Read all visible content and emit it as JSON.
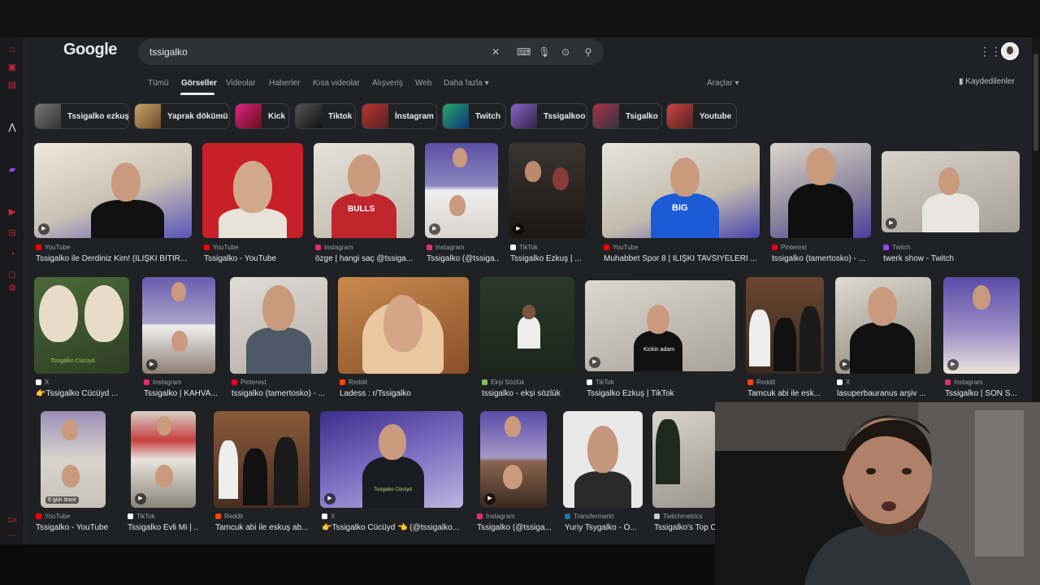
{
  "search": {
    "query": "tssigalko",
    "logo": "Google"
  },
  "tabs": [
    {
      "label": "Tümü",
      "active": false
    },
    {
      "label": "Görseller",
      "active": true
    },
    {
      "label": "Videolar",
      "active": false
    },
    {
      "label": "Haberler",
      "active": false
    },
    {
      "label": "Kısa videolar",
      "active": false
    },
    {
      "label": "Alışveriş",
      "active": false
    },
    {
      "label": "Web",
      "active": false
    },
    {
      "label": "Daha fazla ▾",
      "active": false
    }
  ],
  "tools_label": "Araçlar ▾",
  "saved_label": "Kaydedilenler",
  "chips": [
    {
      "label": "Tssigalko ezkuş"
    },
    {
      "label": "Yaprak dökümü"
    },
    {
      "label": "Kick"
    },
    {
      "label": "Tiktok"
    },
    {
      "label": "İnstagram"
    },
    {
      "label": "Twitch"
    },
    {
      "label": "Tssigalkoo"
    },
    {
      "label": "Tsigalko"
    },
    {
      "label": "Youtube"
    }
  ],
  "results": [
    {
      "source": "YouTube",
      "title": "Tssigalko ile Derdiniz Kim! (İLİŞKİ BİTİR...",
      "video": true
    },
    {
      "source": "YouTube",
      "title": "Tssigalko - YouTube",
      "video": false
    },
    {
      "source": "Instagram",
      "title": "özge | hangi saç @tssiga...",
      "video": false
    },
    {
      "source": "Instagram",
      "title": "Tssigalko (@tssiga...",
      "video": true
    },
    {
      "source": "TikTok",
      "title": "Tssigalko Ezkuş | ...",
      "video": true
    },
    {
      "source": "YouTube",
      "title": "Muhabbet Spor 8 | İLİŞKİ TAVSİYELERİ ...",
      "video": false
    },
    {
      "source": "Pinterest",
      "title": "tssigalko (tamertosko) - ...",
      "video": false
    },
    {
      "source": "Twitch",
      "title": "twerk show - Twitch",
      "video": true
    },
    {
      "source": "X",
      "title": "👉Tssigalko Cücüyd ...",
      "video": false
    },
    {
      "source": "Instagram",
      "title": "Tssigalko | KAHVA...",
      "video": true
    },
    {
      "source": "Pinterest",
      "title": "tssigalko (tamertosko) - ...",
      "video": false
    },
    {
      "source": "Reddit",
      "title": "Ladess : r/Tssigalko",
      "video": false
    },
    {
      "source": "Ekşi Sözlük",
      "title": "tssigalko - ekşi sözlük",
      "video": false
    },
    {
      "source": "TikTok",
      "title": "Tssigalko Ezkuş | TikTok",
      "video": true
    },
    {
      "source": "Reddit",
      "title": "Tamcuk abi ile esk...",
      "video": false
    },
    {
      "source": "X",
      "title": "lasuperbauranus arşiv ...",
      "video": true
    },
    {
      "source": "Instagram",
      "title": "Tssigalko | SON S...",
      "video": true
    },
    {
      "source": "YouTube",
      "title": "Tssigalko - YouTube",
      "video": false,
      "badge": "6 gün önce"
    },
    {
      "source": "TikTok",
      "title": "Tssigalko Evli Mi | ...",
      "video": true
    },
    {
      "source": "Reddit",
      "title": "Tamcuk abi ile eskuş ab...",
      "video": false
    },
    {
      "source": "X",
      "title": "👉Tssigalko Cücüyd 👈 (@tssigalko...",
      "video": true
    },
    {
      "source": "Instagram",
      "title": "Tssigalko (@tssiga...",
      "video": true
    },
    {
      "source": "Transfermarkt",
      "title": "Yuriy Tsygalko - O...",
      "video": false
    },
    {
      "source": "Twitchmetrics",
      "title": "Tssigalko's Top C...",
      "video": false
    }
  ],
  "thumb_captions": [
    "BULLS",
    "BIG",
    "Kickin adam",
    "Tssigalko Cücüyd"
  ],
  "colors": {
    "youtube": "#ff0000",
    "instagram": "#e1306c",
    "tiktok": "#ffffff",
    "pinterest": "#e60023",
    "twitch": "#9146ff",
    "x": "#ffffff",
    "reddit": "#ff4500",
    "eksi": "#81c14b",
    "transfermarkt": "#1d75a3",
    "twitchmetrics": "#cccccc"
  }
}
